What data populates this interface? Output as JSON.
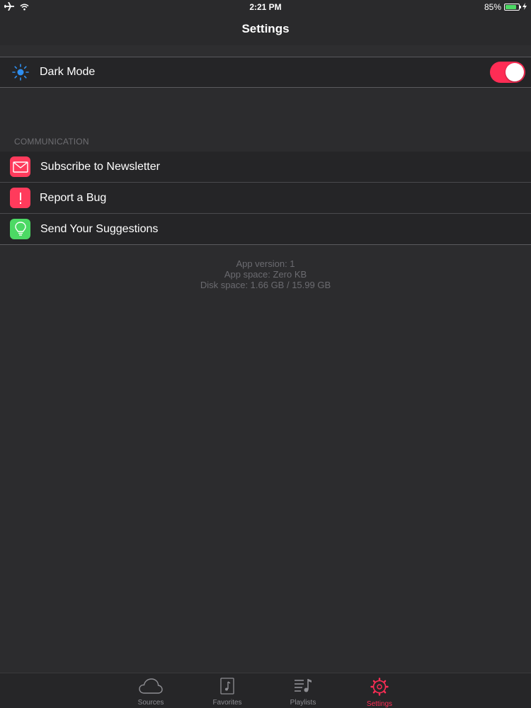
{
  "status_bar": {
    "time": "2:21 PM",
    "battery": "85%",
    "battery_level": 0.85
  },
  "nav": {
    "title": "Settings"
  },
  "appearance": {
    "dark_mode_label": "Dark Mode",
    "dark_mode_on": true,
    "icon": "sun-icon",
    "icon_color": "#2f8ff0"
  },
  "communication": {
    "header": "COMMUNICATION",
    "items": [
      {
        "label": "Subscribe to Newsletter",
        "icon": "envelope-icon",
        "color": "#ff3b5c"
      },
      {
        "label": "Report a Bug",
        "icon": "exclamation-icon",
        "color": "#ff3b5c"
      },
      {
        "label": "Send Your Suggestions",
        "icon": "lightbulb-icon",
        "color": "#4cd964"
      }
    ]
  },
  "info": {
    "app_version": "App version: 1",
    "app_space": "App space: Zero KB",
    "disk_space": "Disk space: 1.66 GB / 15.99 GB"
  },
  "tabs": [
    {
      "label": "Sources",
      "icon": "cloud-icon",
      "active": false
    },
    {
      "label": "Favorites",
      "icon": "music-note-icon",
      "active": false
    },
    {
      "label": "Playlists",
      "icon": "playlist-icon",
      "active": false
    },
    {
      "label": "Settings",
      "icon": "gear-icon",
      "active": true
    }
  ],
  "colors": {
    "accent": "#ff2d55",
    "background": "#2c2c2e",
    "cell": "#252527"
  }
}
